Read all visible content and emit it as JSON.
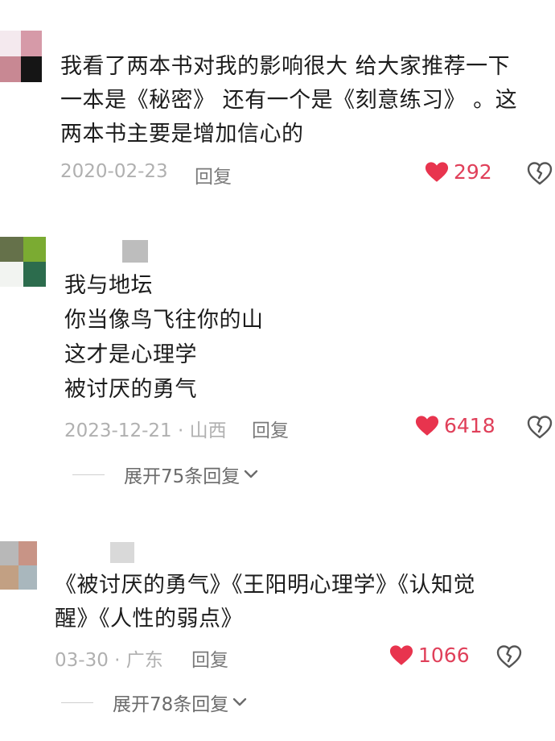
{
  "comments": [
    {
      "text": "我看了两本书对我的影响很大 给大家推荐一下\n一本是《秘密》 还有一个是《刻意练习》 。这\n两本书主要是增加信心的",
      "meta": "2020-02-23",
      "reply_label": "回复",
      "likes": "292",
      "avatar_colors": [
        "#f4e9ee",
        "#d69aa8",
        "#c88893",
        "#151515"
      ]
    },
    {
      "text": "我与地坛\n你当像鸟飞往你的山\n这才是心理学\n被讨厌的勇气",
      "meta": "2023-12-21 · 山西",
      "reply_label": "回复",
      "likes": "6418",
      "expand_label": "展开75条回复",
      "avatar_colors": [
        "#65714a",
        "#7bab32",
        "#f2f4f1",
        "#2c6c4d"
      ]
    },
    {
      "text": "《被讨厌的勇气》《王阳明心理学》《认知觉\n醒》《人性的弱点》",
      "meta": "03-30 · 广东",
      "reply_label": "回复",
      "likes": "1066",
      "expand_label": "展开78条回复",
      "avatar_colors": [
        "#b8b8b8",
        "#c89486",
        "#c2a083",
        "#a9b7bd"
      ]
    }
  ],
  "colors": {
    "like_heart": "#e8344e",
    "meta_gray": "#b0b0b0",
    "reply_gray": "#7a7a7a"
  },
  "icons": [
    "heart-icon",
    "broken-heart-icon",
    "chevron-down-icon"
  ]
}
